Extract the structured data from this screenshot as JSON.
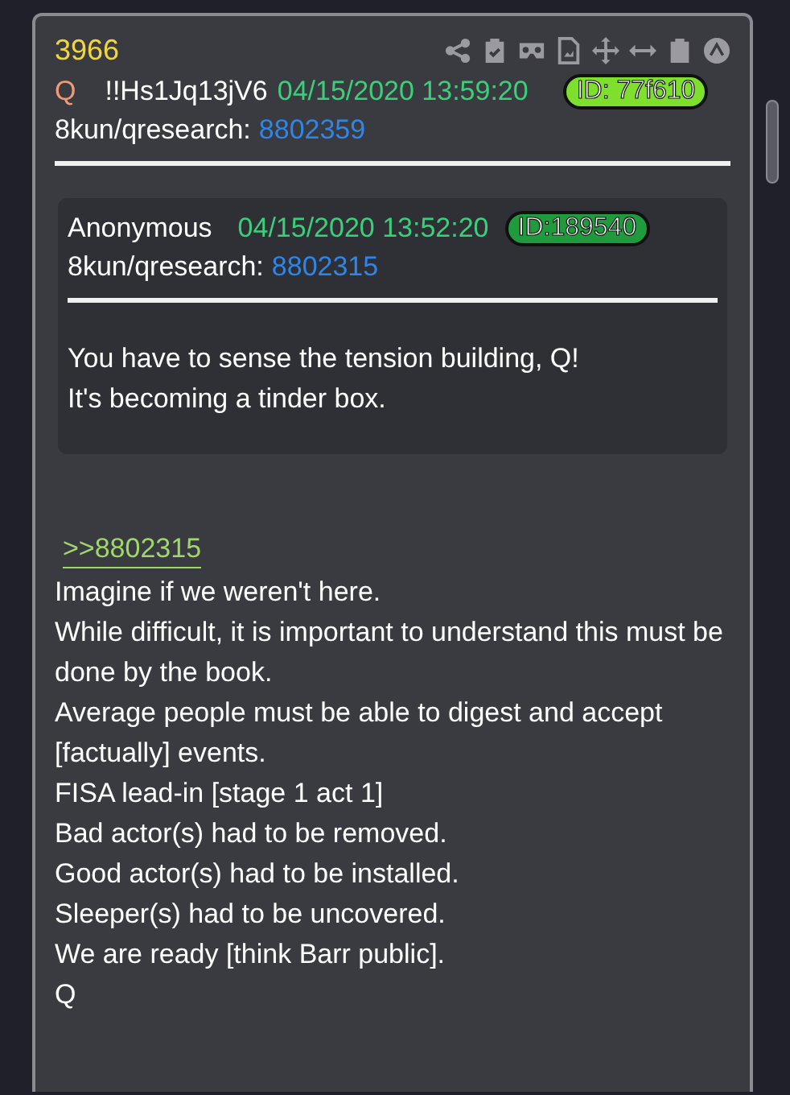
{
  "post": {
    "number": "3966",
    "author": "Q",
    "tripcode": "!!Hs1Jq13jV6",
    "timestamp": "04/15/2020 13:59:20",
    "id_badge": {
      "text": "ID: 77f610",
      "color": "#7ee02c"
    },
    "board": "8kun/qresearch:",
    "post_link": "8802359",
    "quote": {
      "author": "Anonymous",
      "timestamp": "04/15/2020 13:52:20",
      "id_badge": {
        "text": "ID:189540",
        "color": "#1f9a3c"
      },
      "board": "8kun/qresearch:",
      "post_link": "8802315",
      "lines": [
        "You have to sense the tension building, Q!",
        "It's becoming a tinder box."
      ]
    },
    "reply_link": ">>8802315",
    "lines": [
      "Imagine if we weren't here.",
      "While difficult, it is important to understand this must be done by the book.",
      "Average people must be able to digest and accept [factually] events.",
      "FISA lead-in [stage 1 act 1]",
      "Bad actor(s) had to be removed.",
      "Good actor(s) had to be installed.",
      "Sleeper(s) had to be uncovered.",
      "We are ready [think Barr public].",
      "Q"
    ]
  }
}
